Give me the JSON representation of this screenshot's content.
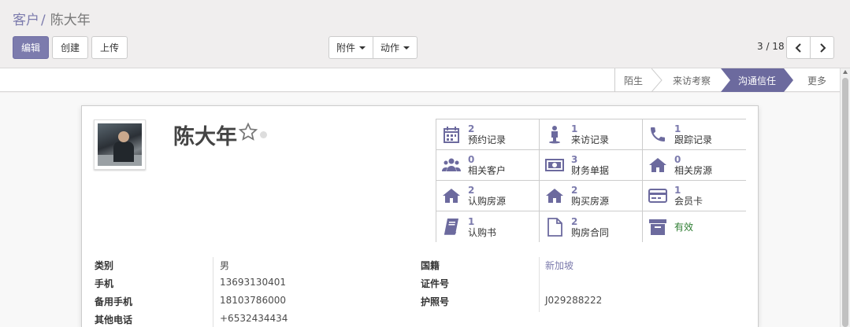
{
  "breadcrumb": {
    "parent": "客户",
    "separator": "/",
    "current": "陈大年"
  },
  "toolbar": {
    "edit": "编辑",
    "create": "创建",
    "upload": "上传",
    "attachment": "附件",
    "action": "动作"
  },
  "pager": {
    "value": "3 / 18"
  },
  "stages": [
    {
      "label": "陌生"
    },
    {
      "label": "来访考察"
    },
    {
      "label": "沟通信任"
    },
    {
      "label": "更多"
    }
  ],
  "record": {
    "name": "陈大年"
  },
  "smart_buttons": [
    {
      "num": "2",
      "label": "预约记录",
      "icon": "calendar-icon"
    },
    {
      "num": "1",
      "label": "来访记录",
      "icon": "person-icon"
    },
    {
      "num": "1",
      "label": "跟踪记录",
      "icon": "phone-icon"
    },
    {
      "num": "0",
      "label": "相关客户",
      "icon": "users-icon"
    },
    {
      "num": "3",
      "label": "财务单据",
      "icon": "money-icon"
    },
    {
      "num": "0",
      "label": "相关房源",
      "icon": "home-icon"
    },
    {
      "num": "2",
      "label": "认购房源",
      "icon": "home-icon"
    },
    {
      "num": "2",
      "label": "购买房源",
      "icon": "home-icon"
    },
    {
      "num": "1",
      "label": "会员卡",
      "icon": "credit-card-icon"
    },
    {
      "num": "1",
      "label": "认购书",
      "icon": "book-icon"
    },
    {
      "num": "2",
      "label": "购房合同",
      "icon": "file-icon"
    },
    {
      "num": "",
      "label": "有效",
      "icon": "archive-icon"
    }
  ],
  "fields_left": [
    {
      "label": "类别",
      "value": "男"
    },
    {
      "label": "手机",
      "value": "13693130401"
    },
    {
      "label": "备用手机",
      "value": "18103786000"
    },
    {
      "label": "其他电话",
      "value": "+6532434434"
    }
  ],
  "fields_right": [
    {
      "label": "国籍",
      "value": "新加坡"
    },
    {
      "label": "证件号",
      "value": ""
    },
    {
      "label": "护照号",
      "value": "J029288222"
    }
  ],
  "colors": {
    "primary": "#7c7bad",
    "active_stage": "#6c6a9e",
    "active_status": "#2e7d32"
  }
}
